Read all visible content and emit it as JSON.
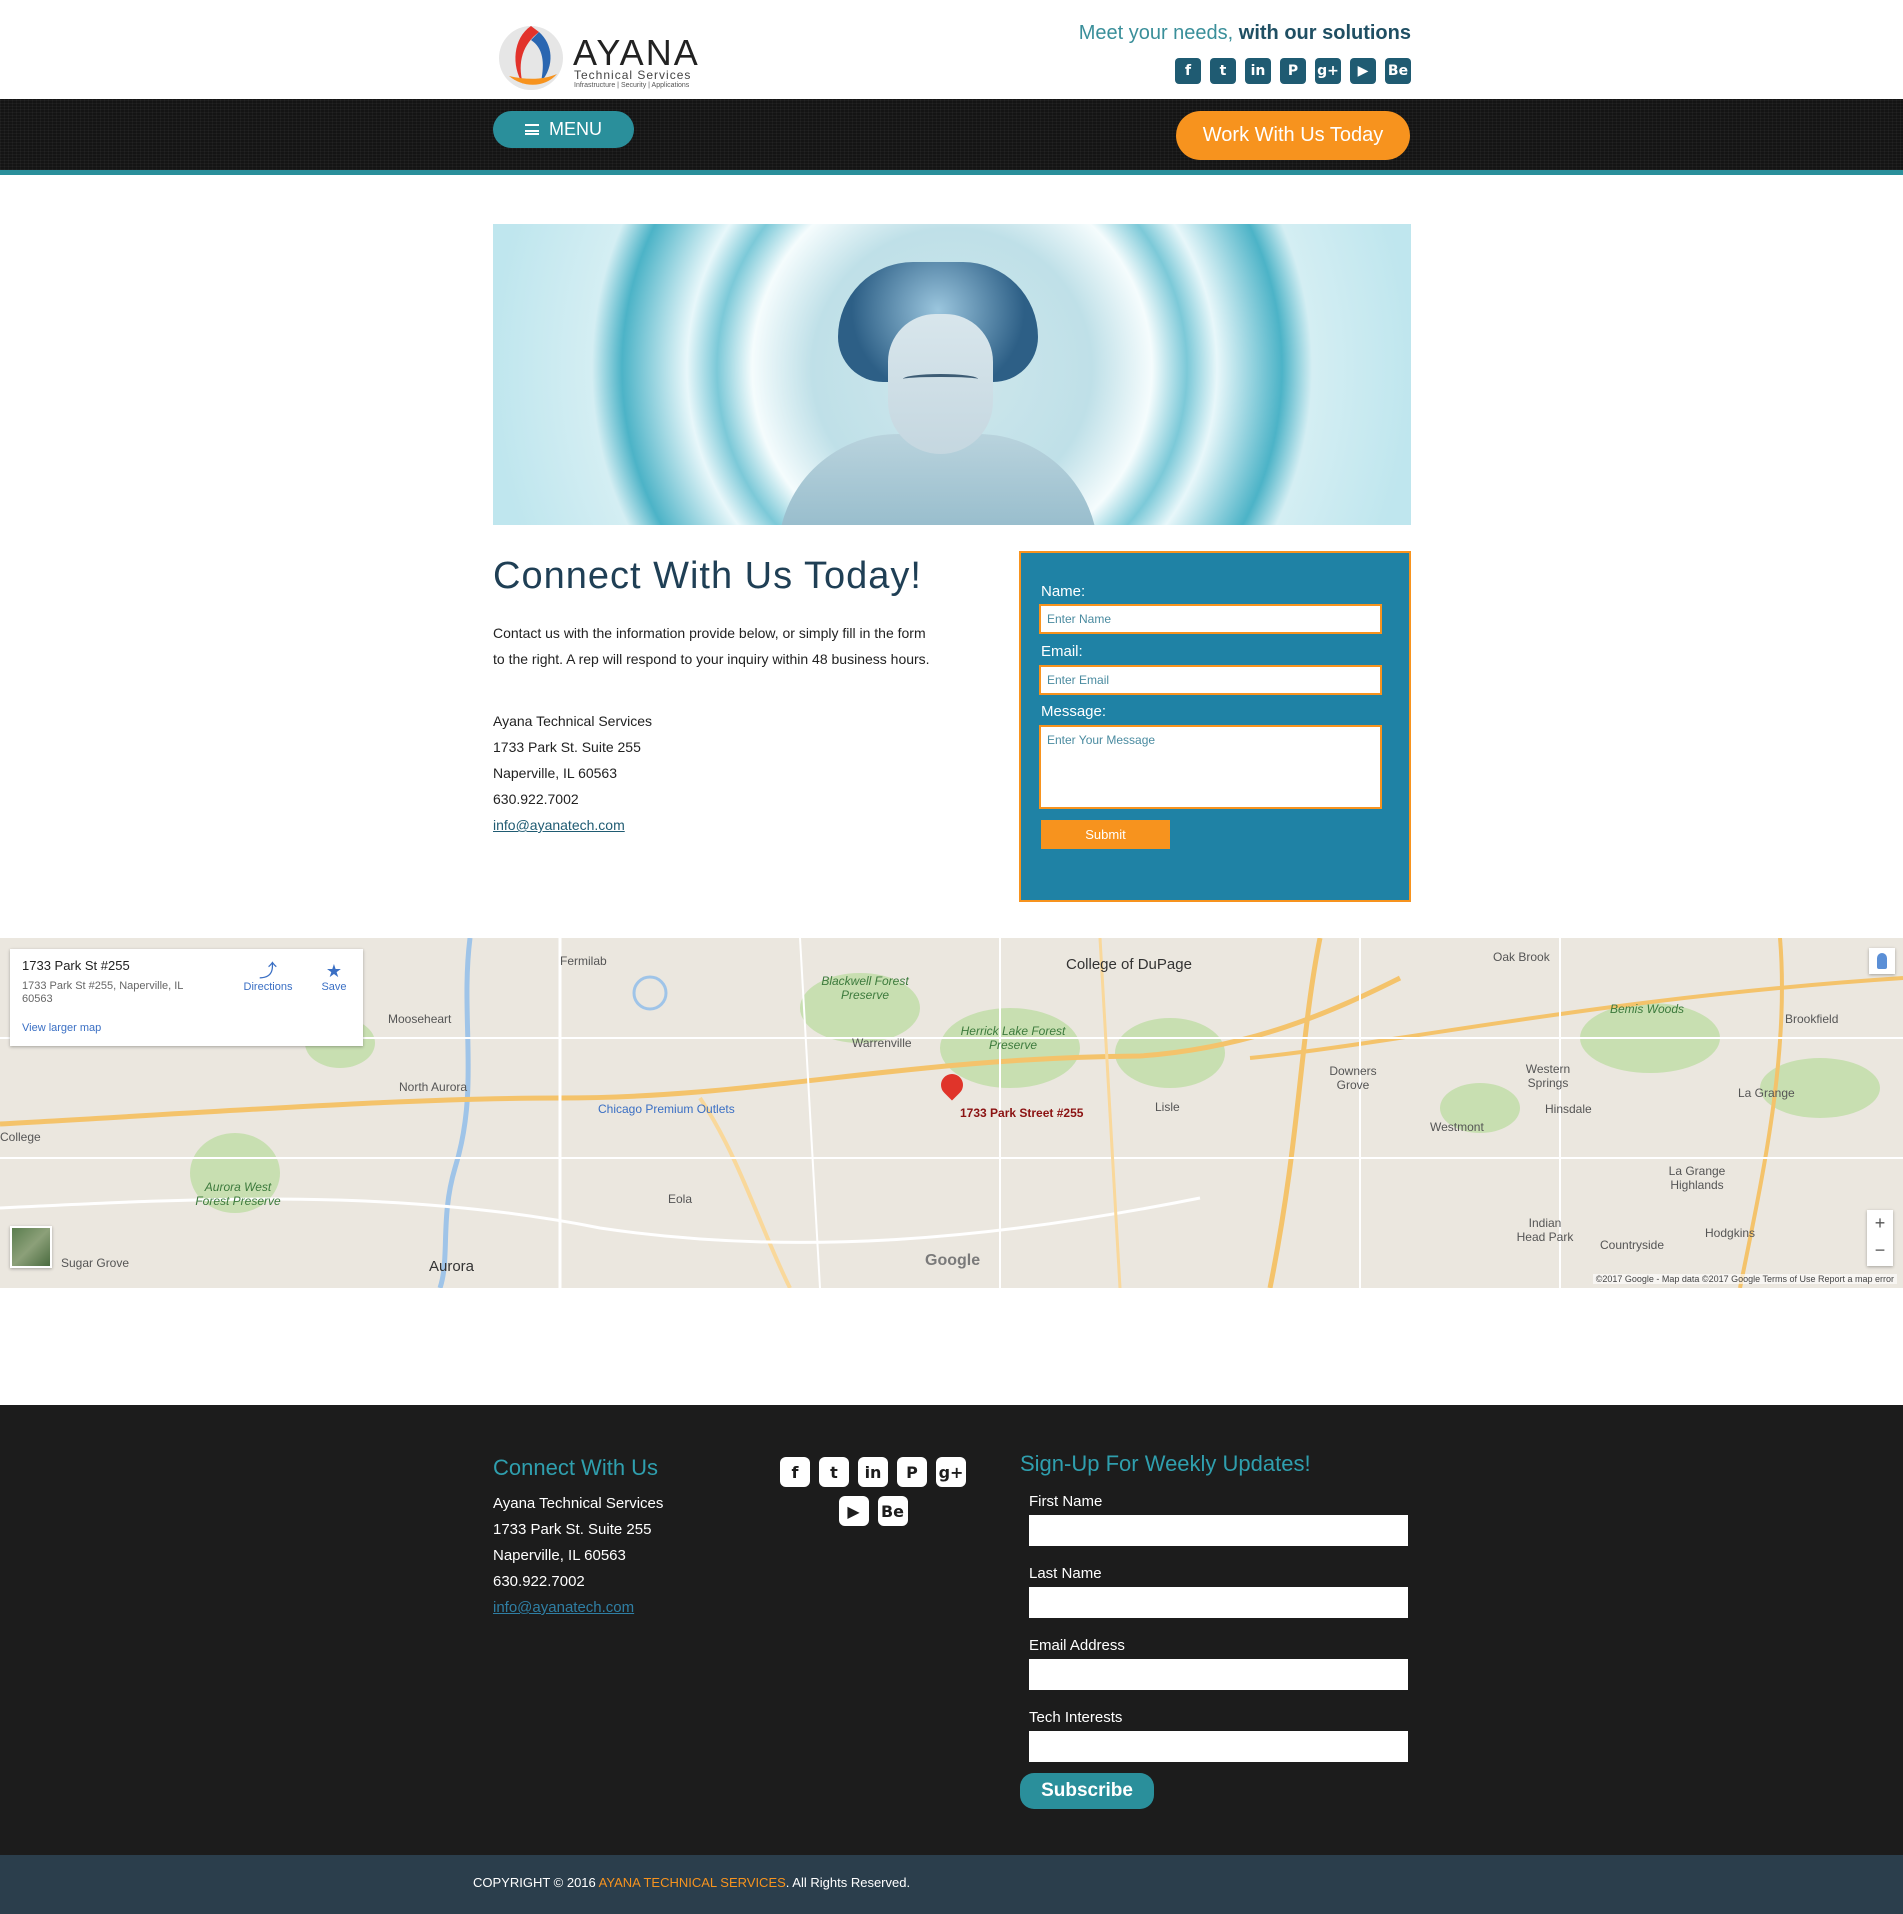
{
  "header": {
    "logo": {
      "brand": "AYANA",
      "subtitle": "Technical Services",
      "tagline_small": "Infrastructure | Security | Applications"
    },
    "tagline_prefix": "Meet your needs, ",
    "tagline_bold": "with our solutions",
    "social": [
      {
        "icon": "facebook-icon",
        "glyph": "f"
      },
      {
        "icon": "twitter-icon",
        "glyph": "t"
      },
      {
        "icon": "linkedin-icon",
        "glyph": "in"
      },
      {
        "icon": "pinterest-icon",
        "glyph": "P"
      },
      {
        "icon": "google-plus-icon",
        "glyph": "g+"
      },
      {
        "icon": "youtube-icon",
        "glyph": "▶"
      },
      {
        "icon": "behance-icon",
        "glyph": "Be"
      }
    ]
  },
  "nav": {
    "menu_label": "MENU",
    "cta_label": "Work With Us Today"
  },
  "connect": {
    "title": "Connect With Us Today!",
    "intro": "Contact us with the information provide below, or simply fill in the form to the right.  A rep will respond to your inquiry within 48 business hours.",
    "company": "Ayana Technical Services",
    "street": "1733 Park St. Suite 255",
    "city": "Naperville, IL 60563",
    "phone": "630.922.7002",
    "email": "info@ayanatech.com"
  },
  "form": {
    "name_label": "Name:",
    "name_placeholder": "Enter Name",
    "email_label": "Email:",
    "email_placeholder": "Enter Email",
    "message_label": "Message:",
    "message_placeholder": "Enter Your Message",
    "submit_label": "Submit"
  },
  "map": {
    "card_title": "1733 Park St #255",
    "card_address": "1733 Park St #255, Naperville, IL 60563",
    "directions_label": "Directions",
    "save_label": "Save",
    "larger_map_label": "View larger map",
    "pin_label": "1733 Park Street #255",
    "places": [
      "Fermilab",
      "College of DuPage",
      "Oak Brook",
      "Blackwell Forest Preserve",
      "Mooseheart",
      "Herrick Lake Forest Preserve",
      "Warrenville",
      "Bemis Woods",
      "Brookfield",
      "North Aurora",
      "Chicago Premium Outlets",
      "Lisle",
      "Downers Grove",
      "Western Springs",
      "La Grange",
      "Hinsdale",
      "Westmont",
      "Aurora West Forest Preserve",
      "Eola",
      "La Grange Highlands",
      "Indian Head Park",
      "Countryside",
      "Hodgkins",
      "Aurora",
      "Sugar Grove",
      "College"
    ],
    "google_label": "Google",
    "attribution": "©2017 Google - Map data ©2017 Google    Terms of Use    Report a map error"
  },
  "footer": {
    "title": "Connect With Us",
    "company": "Ayana Technical Services",
    "street": "1733 Park St.  Suite 255",
    "city": "Naperville, IL 60563",
    "phone": "630.922.7002",
    "email": "info@ayanatech.com",
    "signup_title": "Sign-Up For Weekly Updates!",
    "first_name_label": "First Name",
    "last_name_label": "Last Name",
    "email_label": "Email Address",
    "interests_label": "Tech Interests",
    "subscribe_label": "Subscribe"
  },
  "copyright": {
    "prefix": "COPYRIGHT © 2016 ",
    "company": "AYANA TECHNICAL SERVICES",
    "suffix": ". All Rights Reserved."
  },
  "colors": {
    "teal": "#2a8f9b",
    "orange": "#f7931e",
    "navy": "#1f3f55",
    "form_blue": "#1f82a5",
    "footer_bg": "#1c1c1c",
    "copyright_bg": "#2b3e4c"
  }
}
